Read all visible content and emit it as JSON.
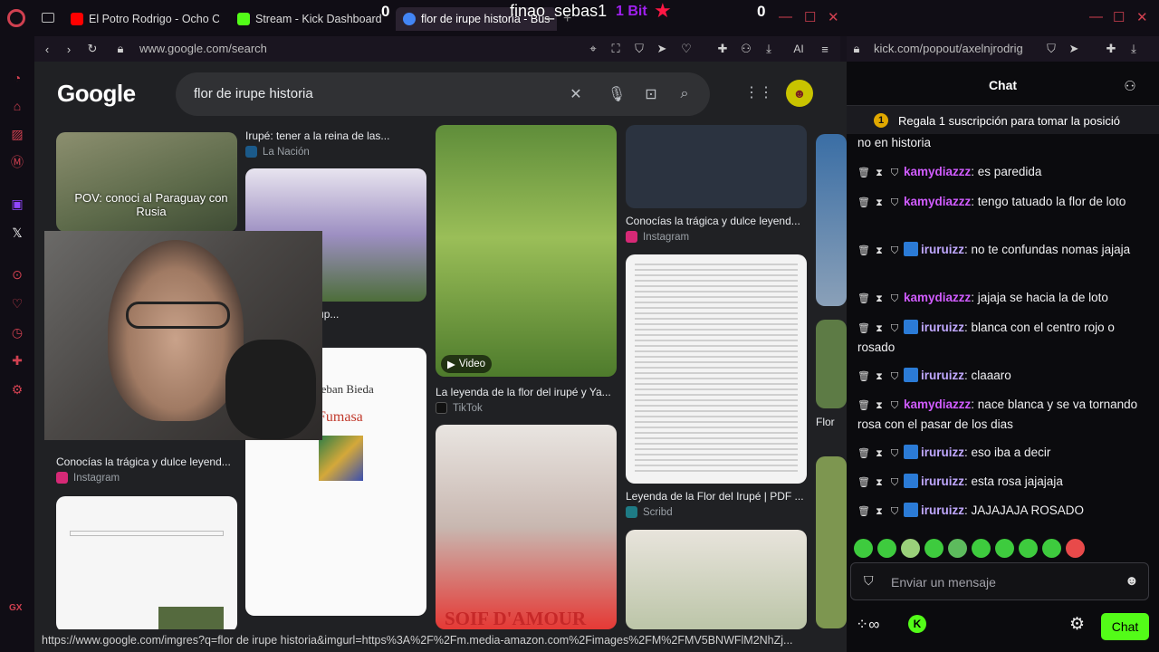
{
  "tabs": [
    {
      "label": "El Potro Rodrigo - Ocho Cu",
      "favicon_color": "#ff0000"
    },
    {
      "label": "Stream - Kick Dashboard",
      "favicon_color": "#53fc18"
    },
    {
      "label": "flor de irupe historia - Bus",
      "favicon_color": "#4285f4"
    }
  ],
  "overlay": {
    "left_count": "0",
    "username": "finao_sebas1",
    "bits": "1 Bit",
    "right_count": "0"
  },
  "left_url": "www.google.com/search",
  "right_url": "kick.com/popout/axelnjrodrig",
  "toolbar_ai": "AI",
  "sidebar_gx": "GX",
  "google": {
    "logo": "Google",
    "query": "flor de irupe historia",
    "results": [
      {
        "caption": "Irupé: tener a la reina de las...",
        "source": "La Nación"
      },
      {
        "caption": "Conocías la trágica y dulce leyend...",
        "source": "Instagram"
      },
      {
        "caption": "de la Flor del Irup..."
      },
      {
        "video_label": "Video"
      },
      {
        "caption": "La leyenda de la flor del irupé y Ya...",
        "source": "TikTok"
      },
      {
        "caption": "Leyenda de la Flor del Irupé | PDF ...",
        "source": "Scribd"
      },
      {
        "caption": "Conocías la trágica y dulce leyend...",
        "source": "Instagram"
      },
      {
        "caption": "Flor"
      }
    ],
    "image_overlay_text": "POV: conoci al Paraguay con Rusia",
    "book_author": "teban Bieda",
    "book_title": "Fumasa",
    "poster_text": "SOIF D'AMOUR"
  },
  "status_url": "https://www.google.com/imgres?q=flor de irupe historia&imgurl=https%3A%2F%2Fm.media-amazon.com%2Fimages%2FM%2FMV5BNWFlM2NhZj...",
  "chat": {
    "title": "Chat",
    "pinned": "Regala 1 suscripción para tomar la posició",
    "pinned_badge": "1",
    "messages": [
      {
        "user": "",
        "text": "no en historia"
      },
      {
        "user": "kamydiazzz",
        "text": ": es paredida"
      },
      {
        "user": "kamydiazzz",
        "text": ": tengo tatuado la flor de loto"
      },
      {
        "user": "iruruizz",
        "text": ": no te confundas nomas jajaja"
      },
      {
        "user": "kamydiazzz",
        "text": ": jajaja se hacia la de loto"
      },
      {
        "user": "iruruizz",
        "text": ": blanca con el centro rojo o rosado"
      },
      {
        "user": "iruruizz",
        "text": ": claaaro"
      },
      {
        "user": "kamydiazzz",
        "text": ": nace blanca y se va tornando rosa con el pasar de los dias"
      },
      {
        "user": "iruruizz",
        "text": ": eso iba a decir"
      },
      {
        "user": "iruruizz",
        "text": ": esta rosa jajajaja"
      },
      {
        "user": "iruruizz",
        "text": ": JAJAJAJA ROSADO"
      }
    ],
    "input_placeholder": "Enviar un mensaje",
    "send_label": "Chat"
  }
}
